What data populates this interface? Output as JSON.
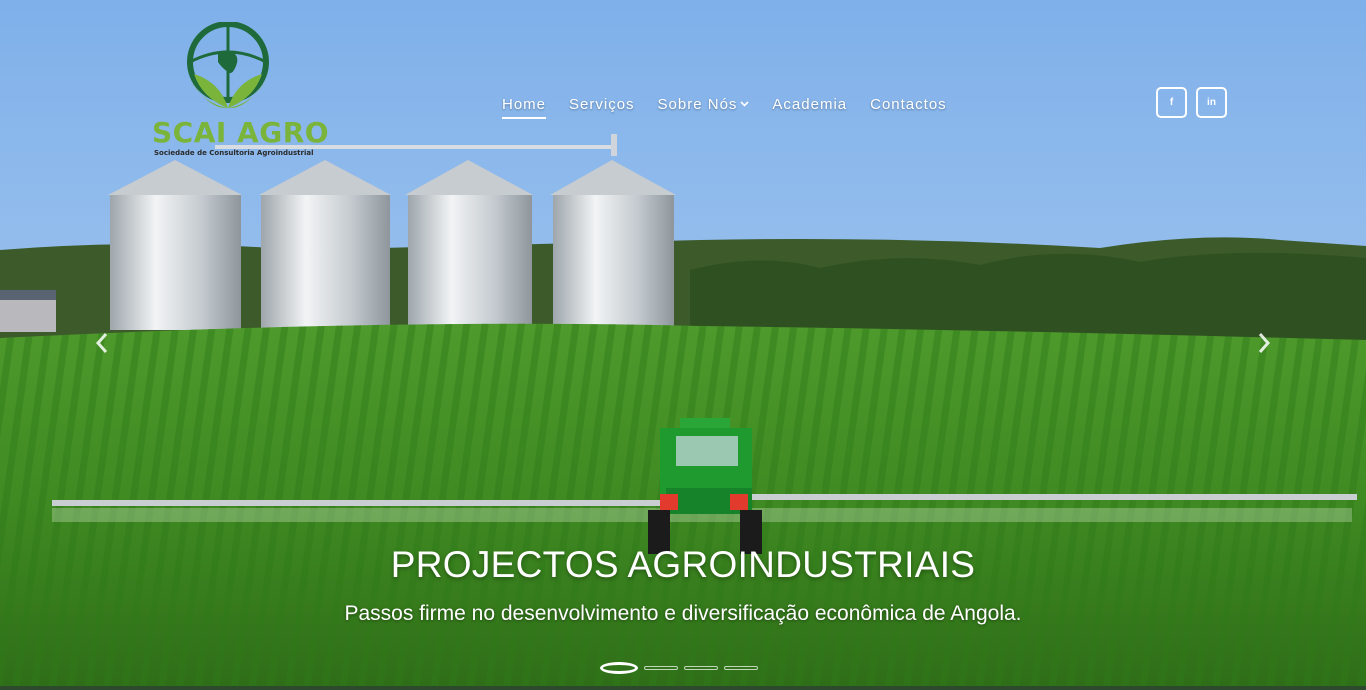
{
  "brand": {
    "name": "SCAI AGRO",
    "tagline": "Sociedade de Consultoria Agroindustrial",
    "colors": {
      "green": "#7ab43a",
      "dark_green": "#1e6a3a"
    }
  },
  "nav": {
    "items": [
      {
        "label": "Home",
        "active": true
      },
      {
        "label": "Serviços"
      },
      {
        "label": "Sobre Nós",
        "has_dropdown": true
      },
      {
        "label": "Academia"
      },
      {
        "label": "Contactos"
      }
    ]
  },
  "social": [
    {
      "label": "f",
      "icon": "facebook-icon"
    },
    {
      "label": "in",
      "icon": "linkedin-icon"
    }
  ],
  "slider": {
    "title": "PROJECTOS AGROINDUSTRIAIS",
    "subtitle": "Passos firme no desenvolvimento e diversificação econômica de Angola.",
    "slides_count": 4,
    "active_slide": 1
  }
}
